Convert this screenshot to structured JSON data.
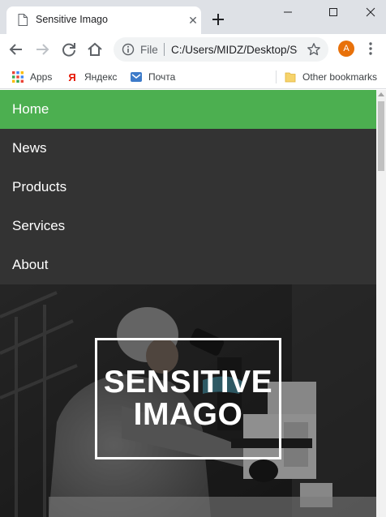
{
  "browser": {
    "tab_title": "Sensitive Imago",
    "tab_close": "✕",
    "omnibox": {
      "scheme_label": "File",
      "url": "C:/Users/MIDZ/Desktop/Sensitive Imago/index.html"
    },
    "profile_initial": "A",
    "bookmarks": [
      {
        "label": "Apps",
        "icon": "apps-grid-icon"
      },
      {
        "label": "Яндекс",
        "icon": "yandex-icon"
      },
      {
        "label": "Почта",
        "icon": "mail-icon"
      }
    ],
    "other_bookmarks": "Other bookmarks"
  },
  "site": {
    "nav": [
      {
        "label": "Home",
        "active": true
      },
      {
        "label": "News",
        "active": false
      },
      {
        "label": "Products",
        "active": false
      },
      {
        "label": "Services",
        "active": false
      },
      {
        "label": "About",
        "active": false
      }
    ],
    "hero": {
      "title_line1": "SENSITIVE",
      "title_line2": "IMAGO",
      "background_description_icon": "lab-microscope-photo"
    }
  },
  "colors": {
    "nav_active": "#4caf50",
    "nav_background": "#333333",
    "avatar": "#e8710a"
  }
}
